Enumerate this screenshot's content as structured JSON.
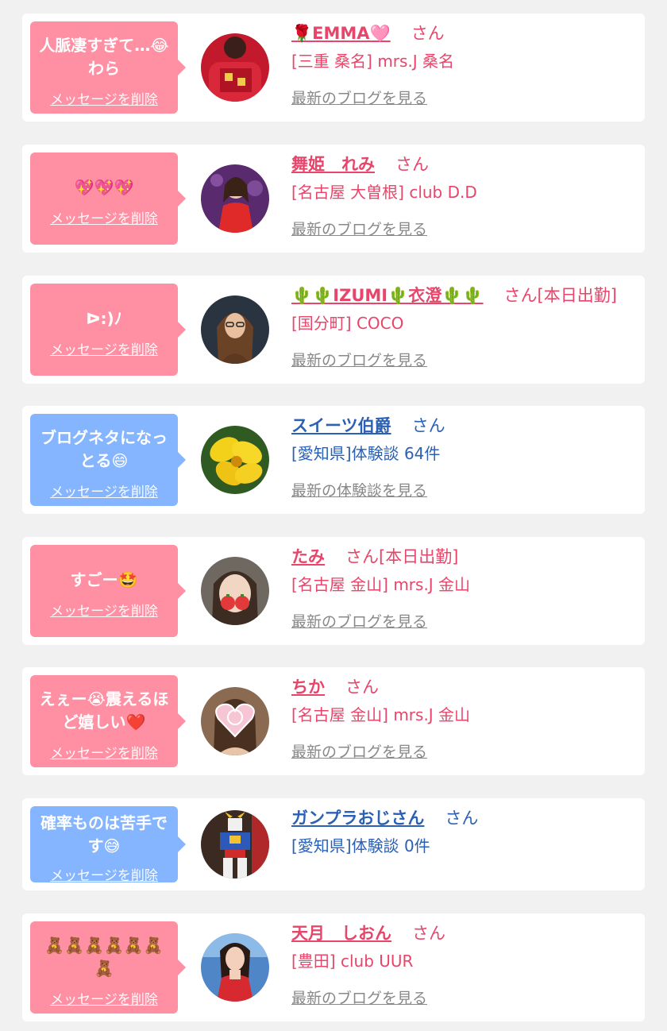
{
  "common": {
    "delete_label": "メッセージを削除",
    "san_suffix": "さん"
  },
  "colors": {
    "pink_bubble": "#ff8fa3",
    "blue_bubble": "#85b5ff",
    "pink_text": "#e8456a",
    "blue_text": "#2a61b4",
    "link_gray": "#888888"
  },
  "items": [
    {
      "bubble_text": "人脈凄すぎて…😂わら",
      "name": "🌹EMMA🩷",
      "suffix": "さん",
      "sub": "[三重 桑名] mrs.J 桑名",
      "link": "最新のブログを見る",
      "avatar_icon": "red-sweater-avatar"
    },
    {
      "bubble_text": "💖💖💖",
      "name": "舞姫　れみ",
      "suffix": "さん",
      "sub": "[名古屋 大曽根] club D.D",
      "link": "最新のブログを見る",
      "avatar_icon": "red-dress-avatar"
    },
    {
      "bubble_text": "ᐅ:)ﾉ",
      "name": "🌵🌵IZUMI🌵衣澄🌵🌵",
      "suffix": "さん[本日出勤]",
      "sub": "[国分町] COCO",
      "link": "最新のブログを見る",
      "avatar_icon": "woman-glasses-avatar"
    },
    {
      "bubble_text": "ブログネタになっとる😄",
      "name": "スイーツ伯爵",
      "suffix": "さん",
      "sub": "[愛知県]体験談 64件",
      "link": "最新の体験談を見る",
      "avatar_icon": "yellow-flower-avatar"
    },
    {
      "bubble_text": "すごー🤩",
      "name": "たみ",
      "suffix": "さん[本日出勤]",
      "sub": "[名古屋 金山] mrs.J 金山",
      "link": "最新のブログを見る",
      "avatar_icon": "strawberry-face-avatar"
    },
    {
      "bubble_text": "えぇー😭震えるほど嬉しい❤️",
      "name": "ちか",
      "suffix": "さん",
      "sub": "[名古屋 金山] mrs.J 金山",
      "link": "最新のブログを見る",
      "avatar_icon": "heart-sticker-avatar"
    },
    {
      "bubble_text": "確率ものは苦手です😅",
      "name": "ガンプラおじさん",
      "suffix": "さん",
      "sub": "[愛知県]体験談 0件",
      "link": "",
      "avatar_icon": "robot-model-avatar"
    },
    {
      "bubble_text": "🧸🧸🧸🧸🧸🧸🧸",
      "name": "天月　しおん",
      "suffix": "さん",
      "sub": "[豊田] club UUR",
      "link": "最新のブログを見る",
      "avatar_icon": "woman-red-avatar"
    }
  ]
}
